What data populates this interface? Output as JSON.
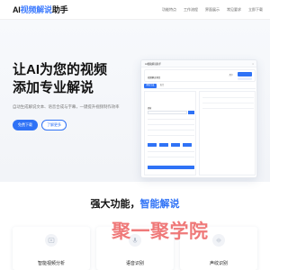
{
  "header": {
    "logo_prefix": "AI",
    "logo_highlight": "视频解说",
    "logo_suffix": "助手",
    "nav": [
      "功能特点",
      "工作流程",
      "界面展示",
      "常见要求",
      "立即下载"
    ]
  },
  "hero": {
    "title_line1": "让AI为您的视频",
    "title_line2": "添加专业解说",
    "subtitle": "自动生成解说文本、语音合成与字幕，一键提升视频制作效率",
    "primary_button": "免费下载",
    "secondary_button": "了解更多"
  },
  "mockup": {
    "app_title": "AI视频解说助手",
    "close_glyph": "×",
    "project_label": "视频解说项目",
    "user_label": "用户",
    "tabs": [
      "解说生成",
      "配音"
    ],
    "section_label": "素材"
  },
  "features": {
    "title_prefix": "强大功能，",
    "title_highlight": "智能解说",
    "cards": [
      {
        "label": "智能视频分析",
        "icon": "video-analysis-icon"
      },
      {
        "label": "语音识别",
        "icon": "speech-recognition-icon"
      },
      {
        "label": "声纹识别",
        "icon": "voiceprint-icon"
      }
    ]
  },
  "watermark": "聚一聚学院",
  "colors": {
    "accent": "#2f72f6",
    "watermark": "#eb5c5c"
  }
}
